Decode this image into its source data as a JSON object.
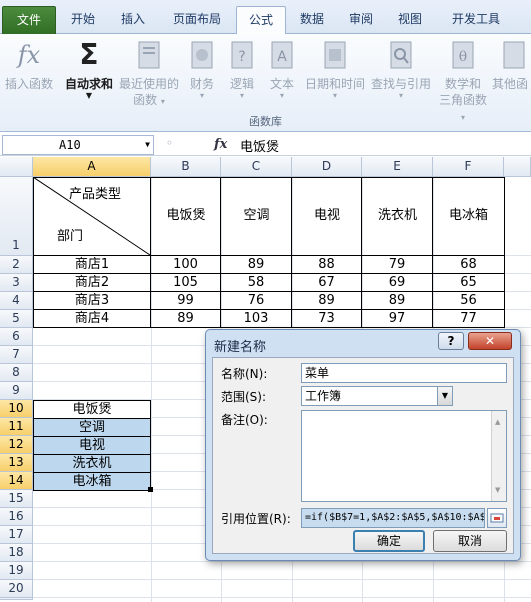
{
  "ribbon": {
    "tabs": [
      "文件",
      "开始",
      "插入",
      "页面布局",
      "公式",
      "数据",
      "审阅",
      "视图",
      "开发工具"
    ],
    "active_tab": "公式",
    "buttons": [
      {
        "label": "插入函数",
        "label2": "",
        "icon": "fx-icon"
      },
      {
        "label": "自动求和",
        "label2": "",
        "icon": "sigma-icon"
      },
      {
        "label": "最近使用的",
        "label2": "函数",
        "icon": "recent-functions-icon"
      },
      {
        "label": "财务",
        "label2": "",
        "icon": "financial-icon"
      },
      {
        "label": "逻辑",
        "label2": "",
        "icon": "logical-icon"
      },
      {
        "label": "文本",
        "label2": "",
        "icon": "text-icon"
      },
      {
        "label": "日期和时间",
        "label2": "",
        "icon": "date-time-icon"
      },
      {
        "label": "查找与引用",
        "label2": "",
        "icon": "lookup-icon"
      },
      {
        "label": "数学和",
        "label2": "三角函数",
        "icon": "math-trig-icon"
      },
      {
        "label": "其他函",
        "label2": "",
        "icon": "more-functions-icon"
      }
    ],
    "group_label": "函数库"
  },
  "formula_bar": {
    "name_box": "A10",
    "fx": "fx",
    "value": "电饭煲"
  },
  "sheet": {
    "columns": [
      "A",
      "B",
      "C",
      "D",
      "E",
      "F"
    ],
    "rows": [
      "1",
      "2",
      "3",
      "4",
      "5",
      "6",
      "7",
      "8",
      "9",
      "10",
      "11",
      "12",
      "13",
      "14",
      "15",
      "16",
      "17",
      "18",
      "19",
      "20",
      "21"
    ],
    "header_diag": {
      "top": "产品类型",
      "bottom": "部门"
    },
    "products": [
      "电饭煲",
      "空调",
      "电视",
      "洗衣机",
      "电冰箱"
    ],
    "stores": [
      {
        "name": "商店1",
        "values": [
          "100",
          "89",
          "88",
          "79",
          "68"
        ]
      },
      {
        "name": "商店2",
        "values": [
          "105",
          "58",
          "67",
          "69",
          "65"
        ]
      },
      {
        "name": "商店3",
        "values": [
          "99",
          "76",
          "89",
          "89",
          "56"
        ]
      },
      {
        "name": "商店4",
        "values": [
          "89",
          "103",
          "73",
          "97",
          "77"
        ]
      }
    ],
    "list_items": [
      "电饭煲",
      "空调",
      "电视",
      "洗衣机",
      "电冰箱"
    ]
  },
  "dialog": {
    "title": "新建名称",
    "help": "?",
    "close": "✕",
    "name_label": "名称(N):",
    "name_value": "菜单",
    "scope_label": "范围(S):",
    "scope_value": "工作簿",
    "comment_label": "备注(O):",
    "ref_label": "引用位置(R):",
    "ref_value": "=if($B$7=1,$A$2:$A$5,$A$10:$A$",
    "ok": "确定",
    "cancel": "取消"
  }
}
